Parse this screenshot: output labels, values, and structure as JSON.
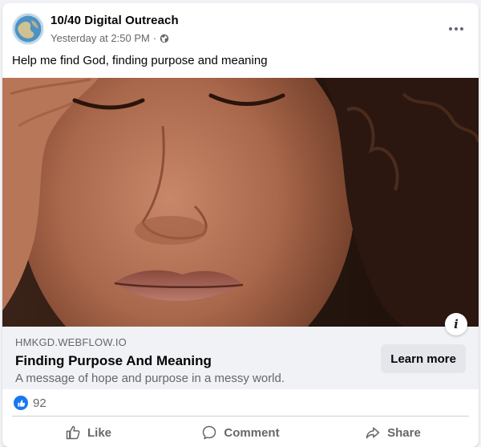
{
  "post": {
    "page_name": "10/40 Digital Outreach",
    "timestamp": "Yesterday at 2:50 PM",
    "separator": "·",
    "visibility_icon": "globe-icon",
    "more_icon": "more-options-icon",
    "text": "Help me find God, finding purpose and meaning"
  },
  "link_preview": {
    "domain": "HMKGD.WEBFLOW.IO",
    "title": "Finding Purpose And Meaning",
    "description": "A message of hope and purpose in a messy world.",
    "cta_label": "Learn more",
    "info_icon": "info-icon",
    "info_glyph": "i"
  },
  "reactions": {
    "icon": "like-reaction-icon",
    "count": "92"
  },
  "actions": [
    {
      "label": "Like",
      "icon": "thumbs-up-icon"
    },
    {
      "label": "Comment",
      "icon": "comment-icon"
    },
    {
      "label": "Share",
      "icon": "share-icon"
    }
  ],
  "colors": {
    "brand_blue": "#1877f2",
    "secondary_text": "#65676b",
    "link_box_bg": "#f0f2f5",
    "button_bg": "#e4e6eb"
  }
}
